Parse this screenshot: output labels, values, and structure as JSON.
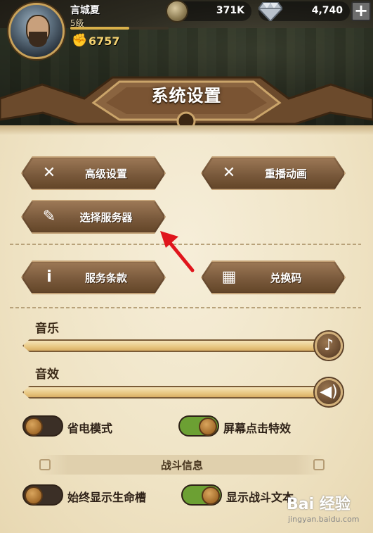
{
  "player": {
    "name": "言城夏",
    "level": "5级",
    "xp_fraction": 0.6,
    "power": "6757"
  },
  "currency": {
    "gold": "371K",
    "gems": "4,740",
    "add_symbol": "+"
  },
  "title": "系统设置",
  "buttons": {
    "advanced_settings": {
      "label": "高级设置",
      "icon": "wrench-screwdriver-icon"
    },
    "replay_animation": {
      "label": "重播动画",
      "icon": "wrench-screwdriver-icon"
    },
    "select_server": {
      "label": "选择服务器",
      "icon": "quill-letter-icon"
    },
    "terms_of_service": {
      "label": "服务条款",
      "icon": "info-icon"
    },
    "redeem_code": {
      "label": "兑换码",
      "icon": "gift-icon"
    }
  },
  "sliders": {
    "music": {
      "label": "音乐",
      "value": 1.0,
      "icon": "music-note-icon"
    },
    "sound_effects": {
      "label": "音效",
      "value": 1.0,
      "icon": "speaker-icon"
    }
  },
  "toggles": {
    "power_saving": {
      "label": "省电模式",
      "on": false
    },
    "tap_effect": {
      "label": "屏幕点击特效",
      "on": true
    },
    "always_show_health": {
      "label": "始终显示生命槽",
      "on": false
    },
    "show_battle_text": {
      "label": "显示战斗文本",
      "on": true
    }
  },
  "section": {
    "battle_info": "战斗信息"
  },
  "colors": {
    "accent_red_arrow": "#e0151c",
    "toggle_on": "#6ca033",
    "toggle_off": "#3b2f26",
    "button_brown": "#7a5a3c"
  },
  "watermark": {
    "main": "Bai 经验",
    "sub": "jingyan.baidu.com"
  }
}
